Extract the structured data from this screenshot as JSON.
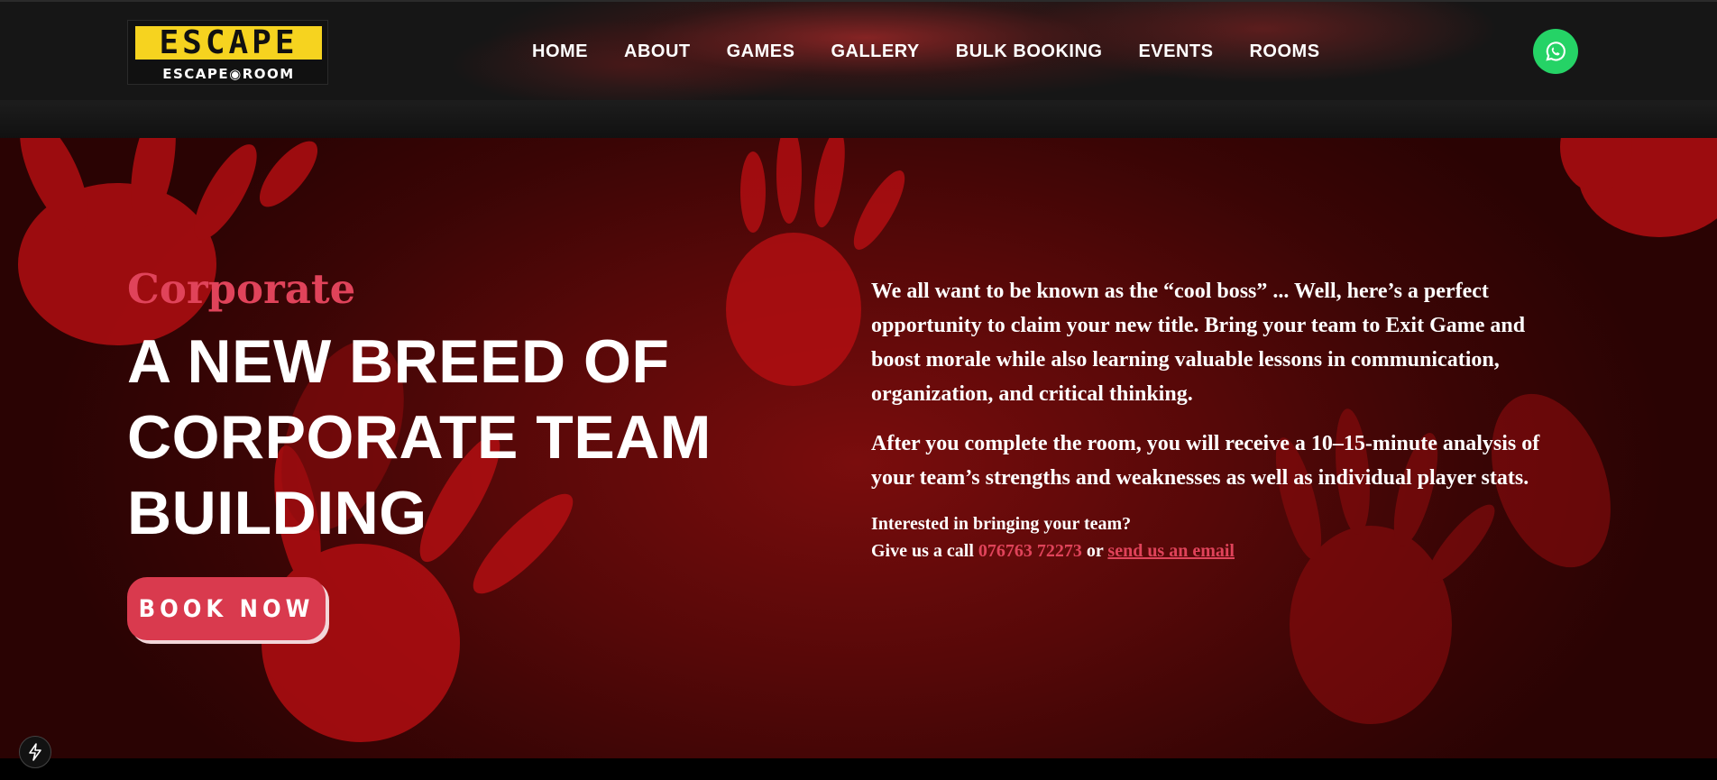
{
  "header": {
    "logo_top": "ESCAPE",
    "logo_bottom": "ESCAPE◉ROOM",
    "nav": [
      "HOME",
      "ABOUT",
      "GAMES",
      "GALLERY",
      "BULK BOOKING",
      "EVENTS",
      "ROOMS"
    ]
  },
  "hero": {
    "eyebrow": "Corporate",
    "headline_line1": "A NEW BREED OF",
    "headline_line2": "CORPORATE TEAM",
    "headline_line3": "BUILDING",
    "book_label": "BOOK NOW",
    "para1": "We all want to be known as the “cool boss” ... Well, here’s a perfect opportunity to claim your new title. Bring your team to Exit Game and boost morale while also learning valuable lessons in communication, organization, and critical thinking.",
    "para2": "After you complete the room, you will receive a 10–15-minute analysis of your team’s strengths and weaknesses as well as individual player stats.",
    "contact_line1": "Interested in bringing your team?",
    "contact_prefix": "Give us a call ",
    "phone": "076763 72273",
    "contact_or": " or ",
    "email_link": "send us an email"
  },
  "colors": {
    "accent": "#e0435a",
    "button": "#d93a4e",
    "whatsapp": "#25d366",
    "logo_yellow": "#f6d31f"
  },
  "icons": {
    "whatsapp": "whatsapp-icon",
    "bolt": "lightning-bolt-icon"
  }
}
